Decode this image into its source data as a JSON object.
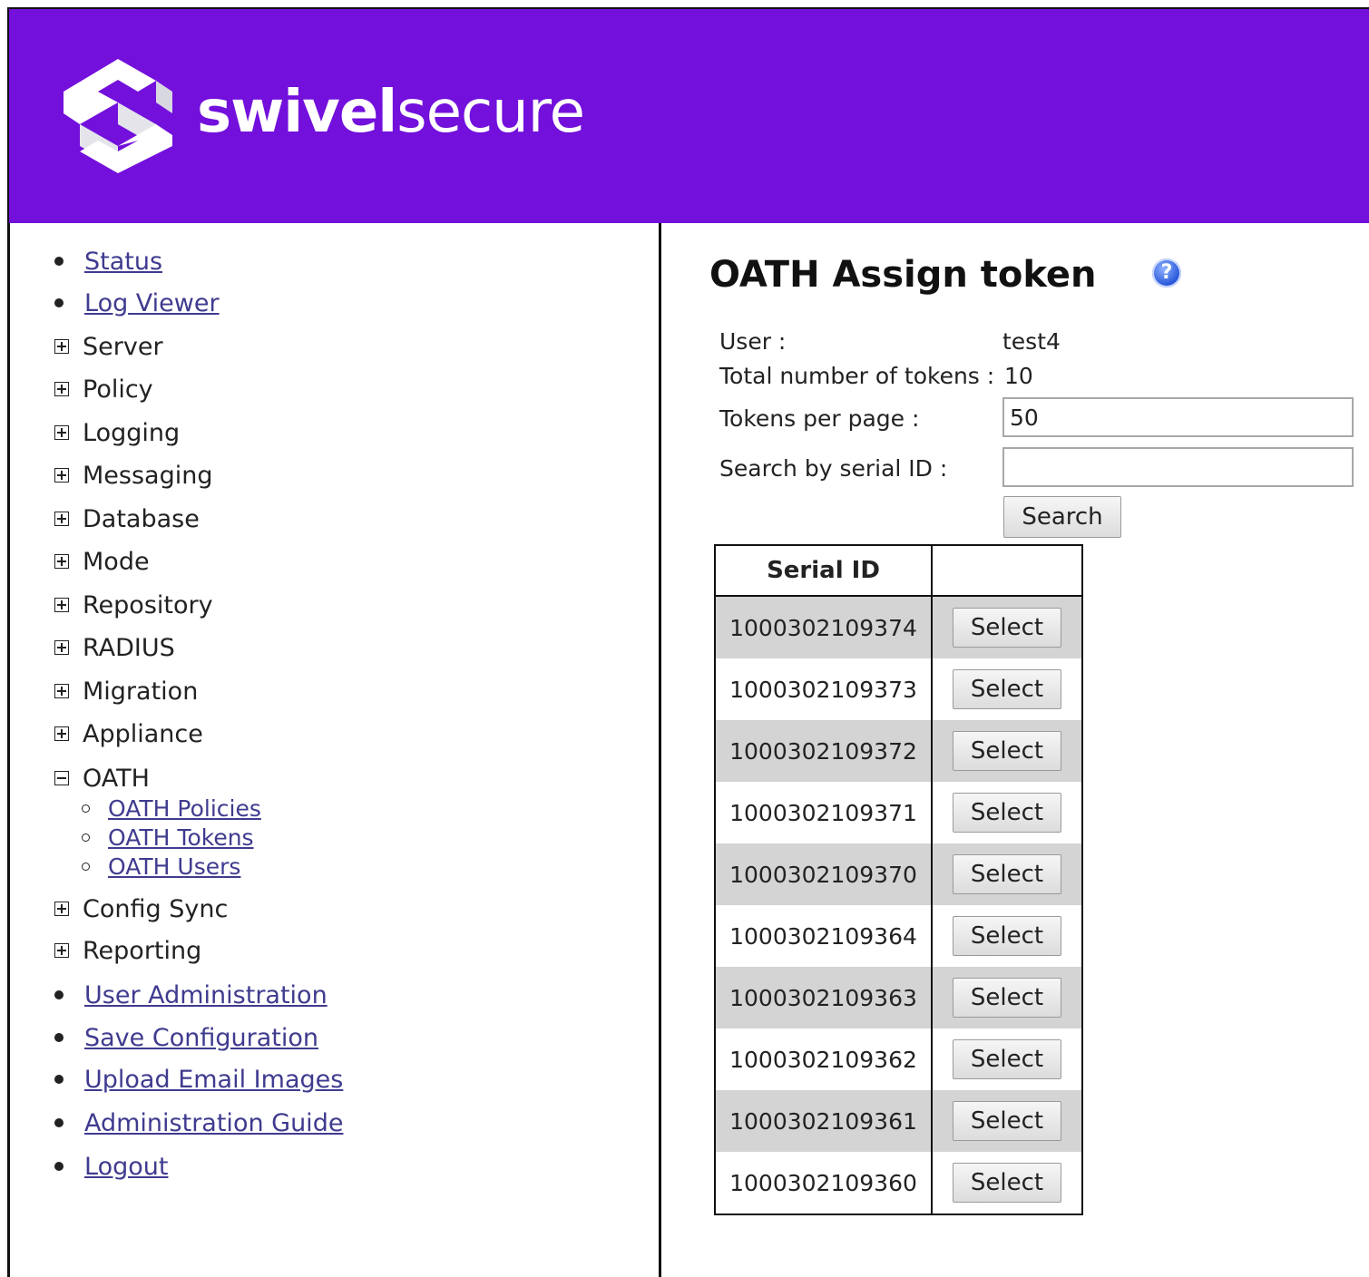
{
  "brand": {
    "name_bold": "swivel",
    "name_light": "secure"
  },
  "nav": {
    "items": [
      {
        "type": "link",
        "label": "Status"
      },
      {
        "type": "link",
        "label": "Log Viewer"
      },
      {
        "type": "folder",
        "label": "Server"
      },
      {
        "type": "folder",
        "label": "Policy"
      },
      {
        "type": "folder",
        "label": "Logging"
      },
      {
        "type": "folder",
        "label": "Messaging"
      },
      {
        "type": "folder",
        "label": "Database"
      },
      {
        "type": "folder",
        "label": "Mode"
      },
      {
        "type": "folder",
        "label": "Repository"
      },
      {
        "type": "folder",
        "label": "RADIUS"
      },
      {
        "type": "folder",
        "label": "Migration"
      },
      {
        "type": "folder",
        "label": "Appliance"
      },
      {
        "type": "folder-open",
        "label": "OATH"
      },
      {
        "type": "folder",
        "label": "Config Sync"
      },
      {
        "type": "folder",
        "label": "Reporting"
      },
      {
        "type": "link",
        "label": "User Administration"
      },
      {
        "type": "link",
        "label": "Save Configuration"
      },
      {
        "type": "link",
        "label": "Upload Email Images"
      },
      {
        "type": "link",
        "label": "Administration Guide"
      },
      {
        "type": "link",
        "label": "Logout"
      }
    ],
    "oath_sub": [
      "OATH Policies",
      "OATH Tokens",
      "OATH Users"
    ]
  },
  "main": {
    "title": "OATH Assign token",
    "user_label": "User :",
    "user_value": "test4",
    "total_label": "Total number of tokens :",
    "total_value": "10",
    "per_page_label": "Tokens per page :",
    "per_page_value": "50",
    "search_label": "Search by serial ID :",
    "search_value": "",
    "search_button": "Search"
  },
  "table": {
    "header_serial": "Serial ID",
    "header_action": "",
    "select_label": "Select",
    "rows": [
      "1000302109374",
      "1000302109373",
      "1000302109372",
      "1000302109371",
      "1000302109370",
      "1000302109364",
      "1000302109363",
      "1000302109362",
      "1000302109361",
      "1000302109360"
    ]
  }
}
